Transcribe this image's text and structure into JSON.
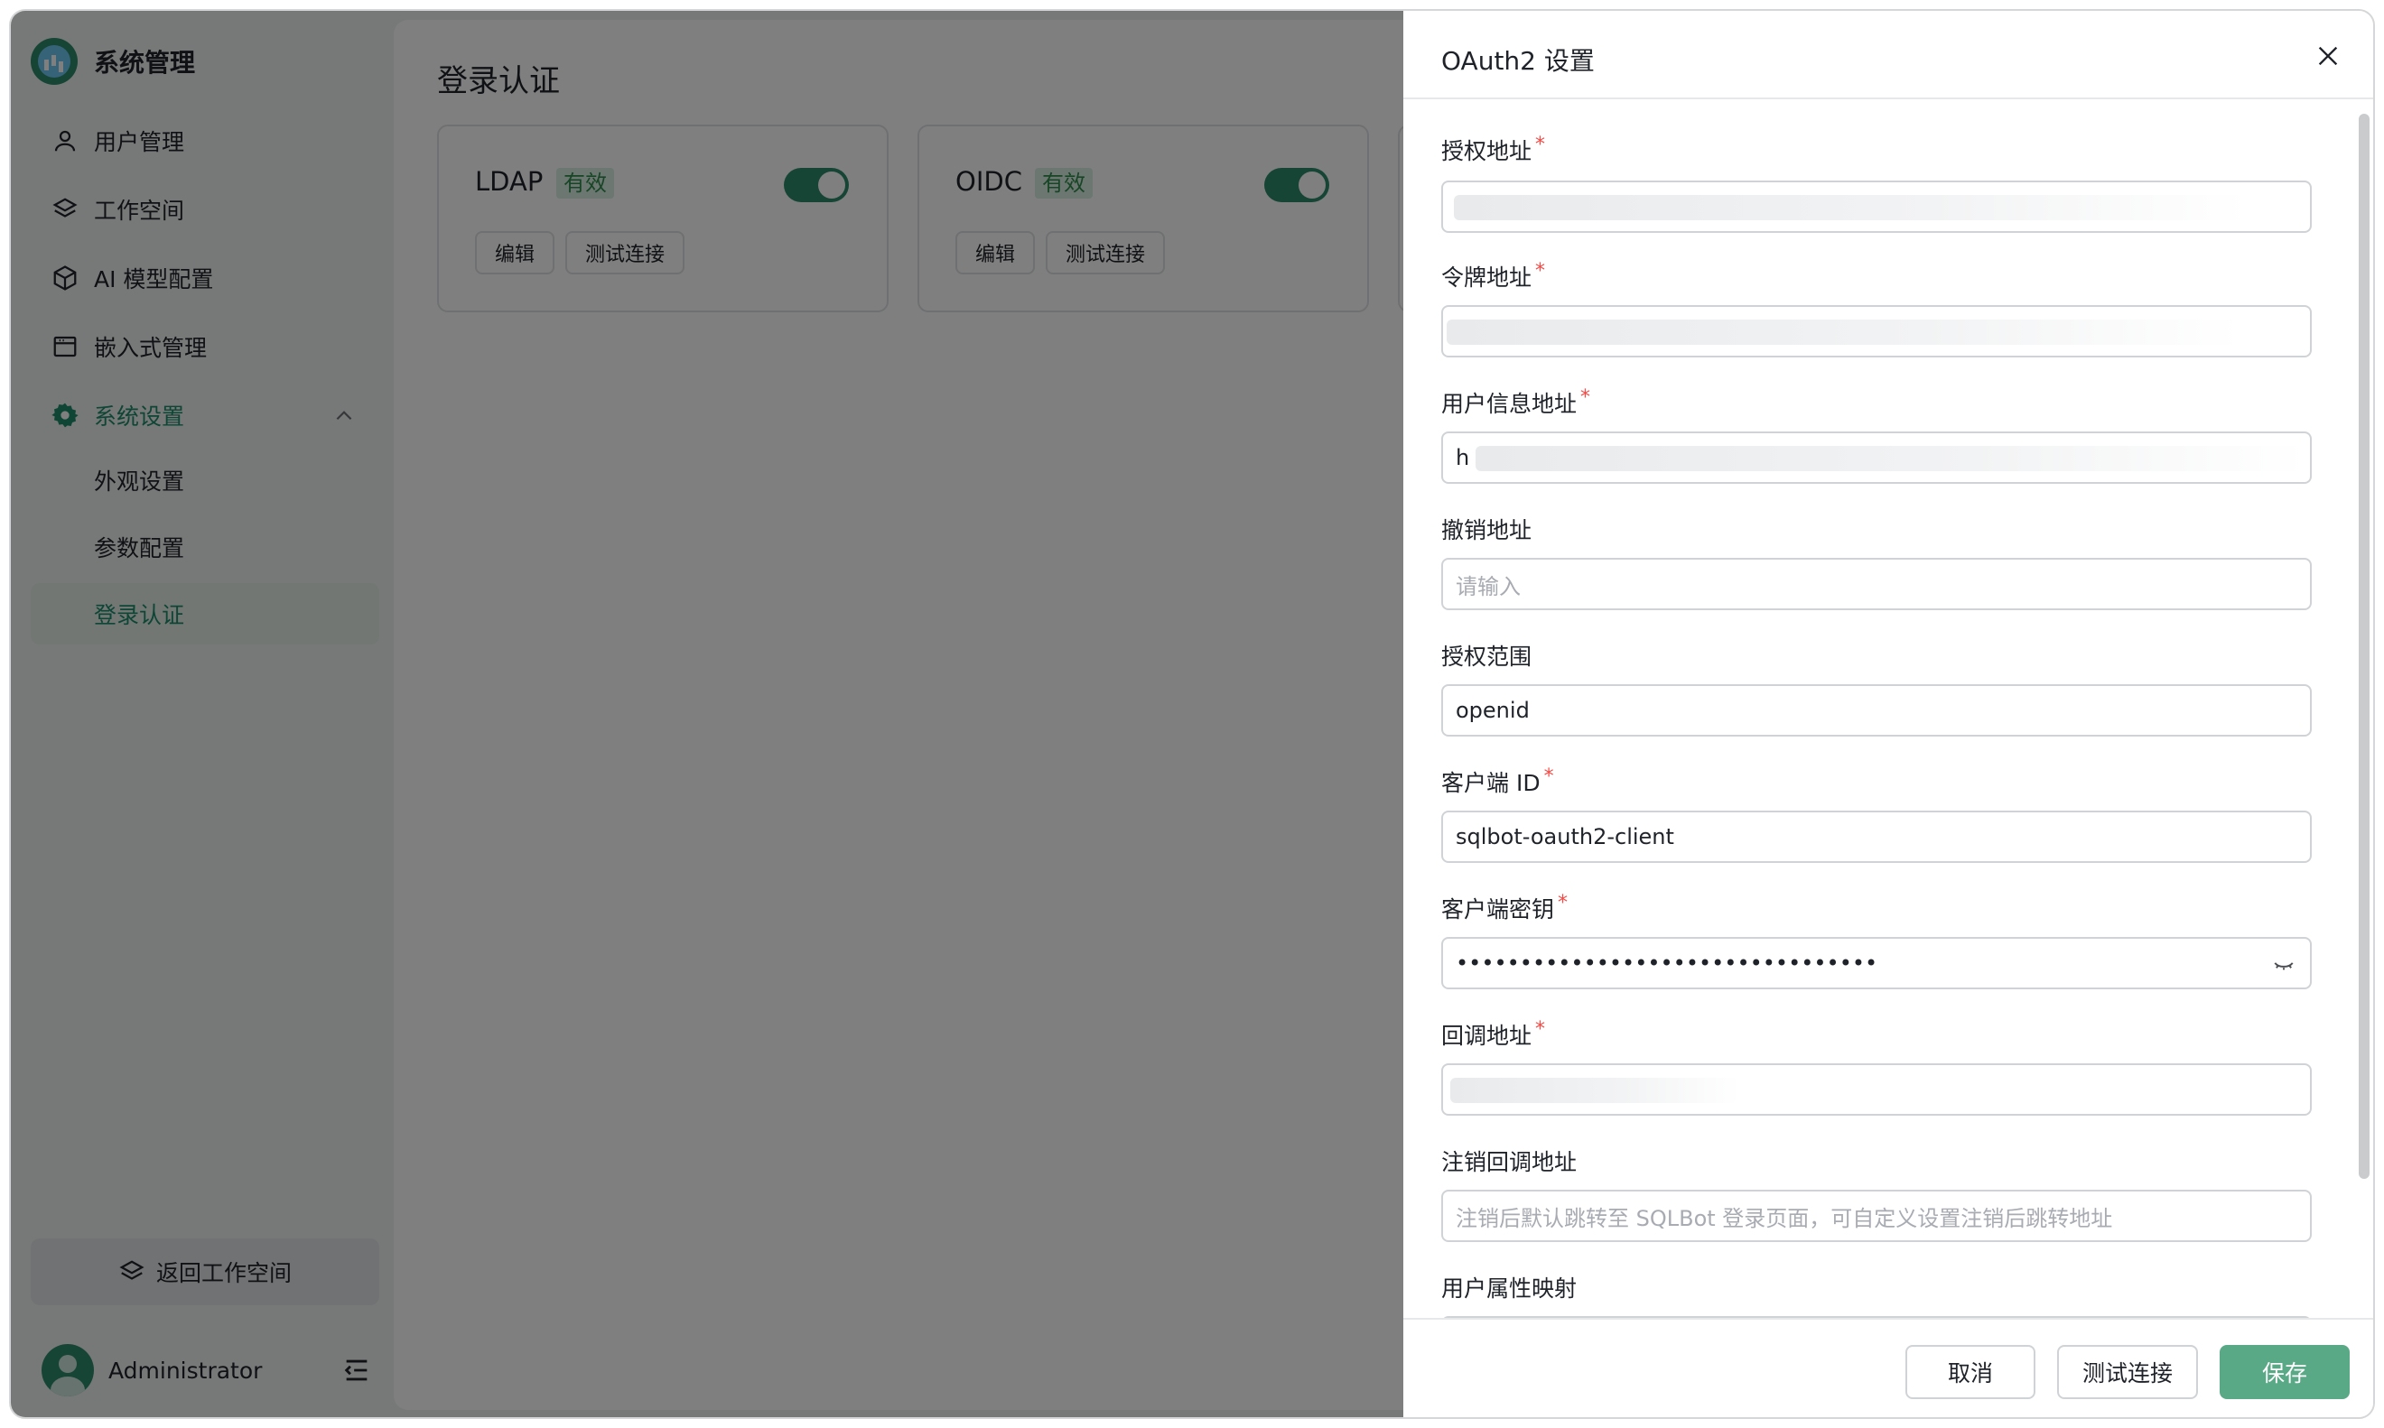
{
  "sidebar": {
    "brand_title": "系统管理",
    "items": [
      {
        "label": "用户管理",
        "icon": "user-icon"
      },
      {
        "label": "工作空间",
        "icon": "layers-icon"
      },
      {
        "label": "AI 模型配置",
        "icon": "cube-icon"
      },
      {
        "label": "嵌入式管理",
        "icon": "window-icon"
      },
      {
        "label": "系统设置",
        "icon": "gear-icon",
        "expanded": true
      }
    ],
    "sub_items": [
      {
        "label": "外观设置"
      },
      {
        "label": "参数配置"
      },
      {
        "label": "登录认证",
        "selected": true
      }
    ],
    "back_label": "返回工作空间",
    "user_name": "Administrator"
  },
  "main": {
    "page_title": "登录认证",
    "cards": [
      {
        "name": "LDAP",
        "badge": "有效",
        "enabled": true,
        "edit_label": "编辑",
        "test_label": "测试连接"
      },
      {
        "name": "OIDC",
        "badge": "有效",
        "enabled": true,
        "edit_label": "编辑",
        "test_label": "测试连接"
      }
    ]
  },
  "drawer": {
    "title": "OAuth2 设置",
    "fields": {
      "auth_url": {
        "label": "授权地址",
        "required": true,
        "value": ""
      },
      "token_url": {
        "label": "令牌地址",
        "required": true,
        "value": ""
      },
      "userinfo_url": {
        "label": "用户信息地址",
        "required": true,
        "value": "h"
      },
      "revoke_url": {
        "label": "撤销地址",
        "required": false,
        "placeholder": "请输入"
      },
      "scope": {
        "label": "授权范围",
        "required": false,
        "value": "openid"
      },
      "client_id": {
        "label": "客户端 ID",
        "required": true,
        "value": "sqlbot-oauth2-client"
      },
      "client_secret": {
        "label": "客户端密钥",
        "required": true,
        "value": "•••••••••••••••••••••••••••••••••"
      },
      "redirect_url": {
        "label": "回调地址",
        "required": true,
        "value": ""
      },
      "logout_redirect_url": {
        "label": "注销回调地址",
        "required": false,
        "placeholder": "注销后默认跳转至 SQLBot 登录页面，可自定义设置注销后跳转地址"
      },
      "user_attr_mapping": {
        "label": "用户属性映射",
        "required": false
      }
    },
    "footer": {
      "cancel_label": "取消",
      "test_label": "测试连接",
      "save_label": "保存"
    },
    "required_mark": "*"
  },
  "colors": {
    "accent": "#2f8a6a",
    "save_button": "#5aa986",
    "required": "#f54a45",
    "badge_bg": "#d8efe4"
  }
}
